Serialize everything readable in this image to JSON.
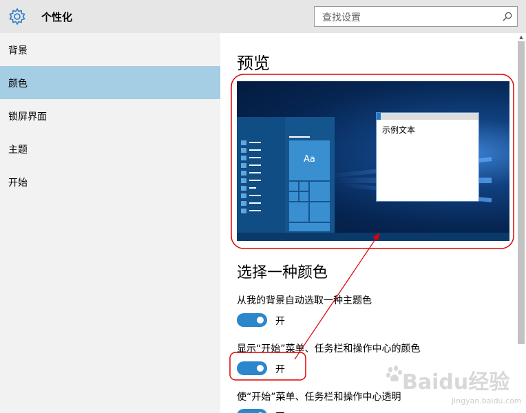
{
  "header": {
    "title": "个性化",
    "search_placeholder": "查找设置",
    "search_icon": "search-icon",
    "gear_icon": "gear-icon"
  },
  "sidebar": {
    "items": [
      {
        "label": "背景"
      },
      {
        "label": "颜色",
        "active": true
      },
      {
        "label": "锁屏界面"
      },
      {
        "label": "主题"
      },
      {
        "label": "开始"
      }
    ]
  },
  "main": {
    "preview_heading": "预览",
    "preview": {
      "tile_label": "Aa",
      "sample_text": "示例文本"
    },
    "color_heading": "选择一种颜色",
    "options": [
      {
        "label": "从我的背景自动选取一种主题色",
        "state": "开"
      },
      {
        "label": "显示“开始”菜单、任务栏和操作中心的颜色",
        "state": "开"
      },
      {
        "label": "使“开始”菜单、任务栏和操作中心透明",
        "state": "开"
      }
    ]
  },
  "colors": {
    "accent": "#2b86cc",
    "sidebar_active": "#a5cde3",
    "header_bg": "#e6e6e6",
    "annotation": "#e00000"
  },
  "watermark": {
    "brand": "Baidu经验",
    "url": "jingyan.baidu.com"
  }
}
